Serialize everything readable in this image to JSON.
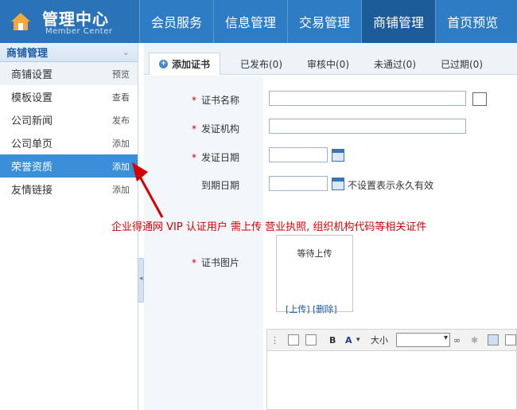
{
  "header": {
    "title": "管理中心",
    "subtitle": "Member Center",
    "nav": [
      "会员服务",
      "信息管理",
      "交易管理",
      "商铺管理",
      "首页预览"
    ],
    "active_nav": "商铺管理"
  },
  "sidebar": {
    "section_title": "商铺管理",
    "items": [
      {
        "label": "商铺设置",
        "action": "预览"
      },
      {
        "label": "模板设置",
        "action": "查看"
      },
      {
        "label": "公司新闻",
        "action": "发布"
      },
      {
        "label": "公司单页",
        "action": "添加"
      },
      {
        "label": "荣誉资质",
        "action": "添加"
      },
      {
        "label": "友情链接",
        "action": "添加"
      }
    ]
  },
  "tabs": [
    {
      "label": "添加证书"
    },
    {
      "label": "已发布(0)"
    },
    {
      "label": "审核中(0)"
    },
    {
      "label": "未通过(0)"
    },
    {
      "label": "已过期(0)"
    }
  ],
  "form": {
    "required_mark": "*",
    "cert_name_label": "证书名称",
    "issuer_label": "发证机构",
    "issue_date_label": "发证日期",
    "expiry_date_label": "到期日期",
    "expiry_hint": "不设置表示永久有效",
    "image_label": "证书图片",
    "upload_placeholder": "等待上传",
    "upload_link": "[上传]",
    "delete_link": "[删除]"
  },
  "editor": {
    "bold": "B",
    "font_color": "A",
    "font_size_label": "大小"
  },
  "annotation": "企业得通网 VIP 认证用户 需上传 营业执照, 组织机构代码等相关证件",
  "colors": {
    "header_blue": "#2d7cc4",
    "active_nav": "#1b5c99",
    "sidebar_active": "#3a8fd8",
    "required_red": "#d40000",
    "annotation_red": "#d40000"
  }
}
